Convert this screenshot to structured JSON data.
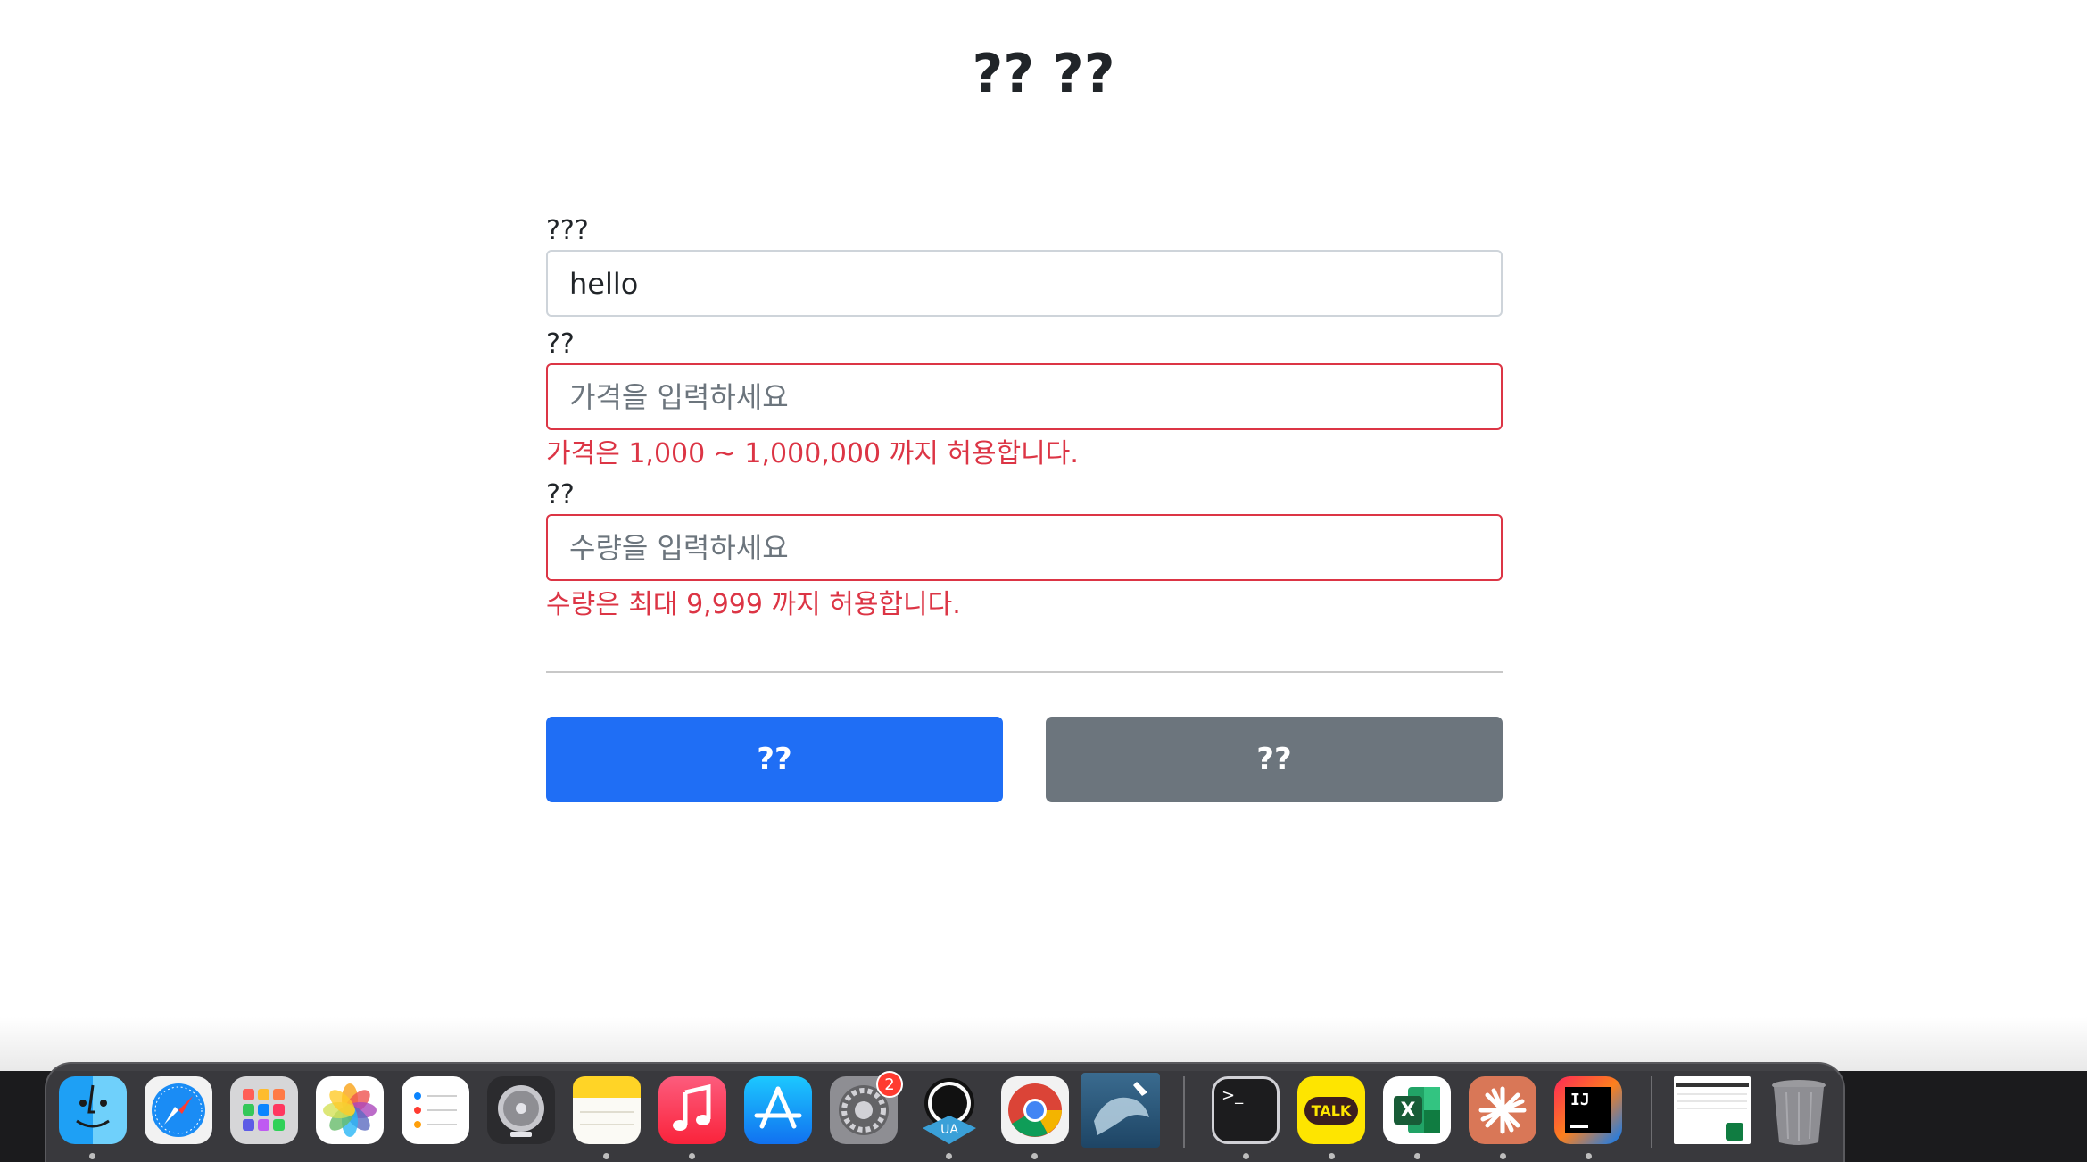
{
  "page": {
    "title": "?? ??"
  },
  "form": {
    "item_name": {
      "label": "???",
      "value": "hello",
      "placeholder": ""
    },
    "price": {
      "label": "??",
      "value": "",
      "placeholder": "가격을 입력하세요",
      "error": "가격은 1,000 ~ 1,000,000 까지 허용합니다."
    },
    "quantity": {
      "label": "??",
      "value": "",
      "placeholder": "수량을 입력하세요",
      "error": "수량은 최대 9,999 까지 허용합니다."
    }
  },
  "buttons": {
    "submit_label": "??",
    "cancel_label": "??"
  },
  "dock": {
    "settings_badge": "2",
    "terminal_glyph": ">_",
    "kakaotalk_label": "TALK",
    "excel_letter": "X",
    "intellij_label": "IJ",
    "apps": [
      {
        "name": "finder",
        "icon": "finder-icon"
      },
      {
        "name": "safari",
        "icon": "safari-icon"
      },
      {
        "name": "launchpad",
        "icon": "launchpad-icon"
      },
      {
        "name": "photos",
        "icon": "photos-icon"
      },
      {
        "name": "reminders",
        "icon": "reminders-icon"
      },
      {
        "name": "logic",
        "icon": "disk-utility-icon"
      },
      {
        "name": "notes",
        "icon": "notes-icon"
      },
      {
        "name": "music",
        "icon": "music-icon"
      },
      {
        "name": "app-store",
        "icon": "app-store-icon"
      },
      {
        "name": "system-settings",
        "icon": "gear-icon"
      },
      {
        "name": "universal-audio",
        "icon": "ua-icon"
      },
      {
        "name": "chrome",
        "icon": "chrome-icon"
      },
      {
        "name": "mysql-workbench",
        "icon": "dolphin-icon"
      },
      {
        "name": "terminal",
        "icon": "terminal-icon"
      },
      {
        "name": "kakaotalk",
        "icon": "kakaotalk-icon"
      },
      {
        "name": "excel",
        "icon": "excel-icon"
      },
      {
        "name": "claude",
        "icon": "asterisk-icon"
      },
      {
        "name": "intellij",
        "icon": "intellij-icon"
      },
      {
        "name": "excel-document",
        "icon": "document-thumbnail-icon"
      },
      {
        "name": "trash",
        "icon": "trash-icon"
      }
    ]
  }
}
